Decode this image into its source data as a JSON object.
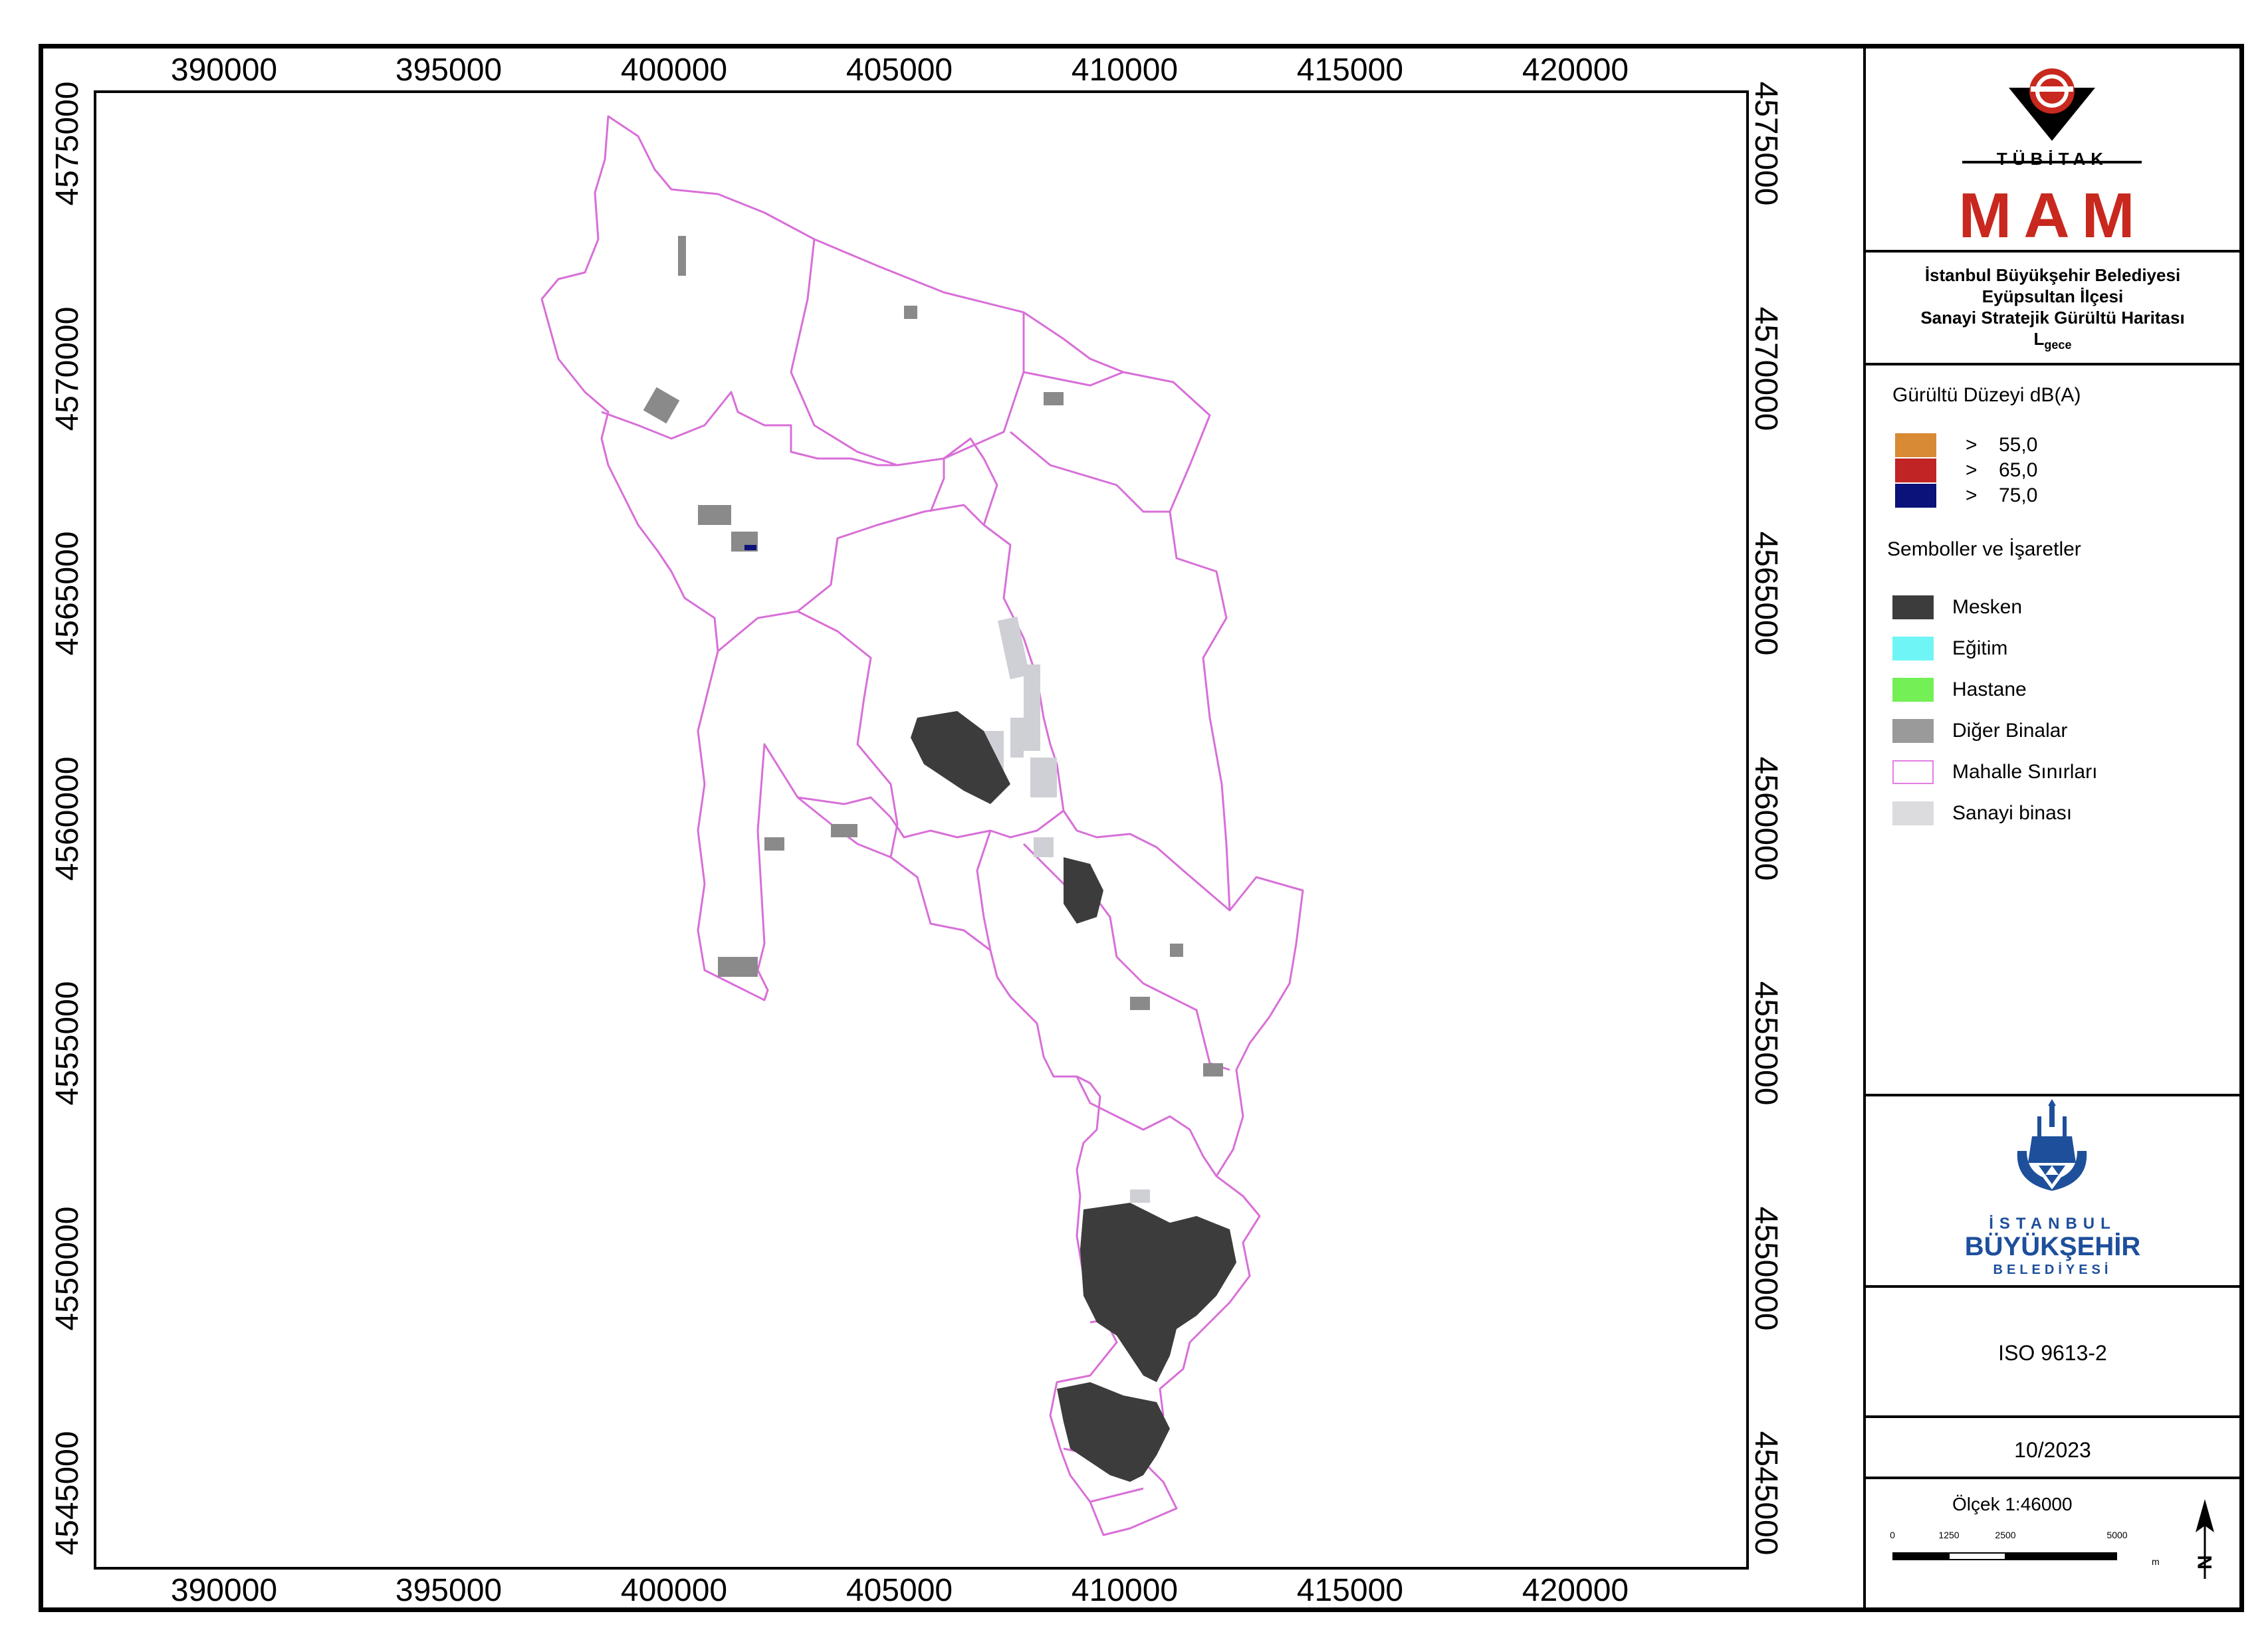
{
  "map": {
    "x_ticks": [
      "390000",
      "395000",
      "400000",
      "405000",
      "410000",
      "415000",
      "420000"
    ],
    "y_ticks": [
      "4575000",
      "4570000",
      "4565000",
      "4560000",
      "4555000",
      "4550000",
      "4545000"
    ]
  },
  "logo_tubitak": {
    "word": "TÜBİTAK",
    "sub": "MAM",
    "color": "#c8281e"
  },
  "title": {
    "line1": "İstanbul Büyükşehir Belediyesi",
    "line2": "Eyüpsultan İlçesi",
    "line3": "Sanayi Stratejik Gürültü Haritası",
    "metric_main": "L",
    "metric_sub": "gece"
  },
  "noise_legend": {
    "title": "Gürültü Düzeyi dB(A)",
    "items": [
      {
        "symbol": ">",
        "value": "55,0",
        "color": "#d98a35"
      },
      {
        "symbol": ">",
        "value": "65,0",
        "color": "#c02424"
      },
      {
        "symbol": ">",
        "value": "75,0",
        "color": "#0b127a"
      }
    ]
  },
  "symbol_legend": {
    "title": "Semboller ve İşaretler",
    "items": [
      {
        "label": "Mesken",
        "color": "#3c3c3c",
        "border": "#3c3c3c"
      },
      {
        "label": "Eğitim",
        "color": "#6ff5f5",
        "border": "#6ff5f5"
      },
      {
        "label": "Hastane",
        "color": "#72f056",
        "border": "#72f056"
      },
      {
        "label": "Diğer Binalar",
        "color": "#9a9a9a",
        "border": "#9a9a9a"
      },
      {
        "label": "Mahalle Sınırları",
        "color": "#ffffff",
        "border": "#e37ee3"
      },
      {
        "label": "Sanayi binası",
        "color": "#dcdcdf",
        "border": "#dcdcdf"
      }
    ]
  },
  "logo_ibb": {
    "line1": "İSTANBUL",
    "line2": "BÜYÜKŞEHİR",
    "line3": "BELEDİYESİ",
    "color": "#1d4f9b"
  },
  "standard": "ISO 9613-2",
  "date": "10/2023",
  "scale": {
    "label": "Ölçek 1:46000",
    "ticks": [
      "0",
      "1250",
      "2500",
      "5000"
    ],
    "unit": "m",
    "north": "N"
  },
  "colors": {
    "boundary": "#d86fd8",
    "building_dark": "#3c3c3c",
    "building_grey": "#8a8a8a",
    "industrial": "#cfcfd6"
  }
}
